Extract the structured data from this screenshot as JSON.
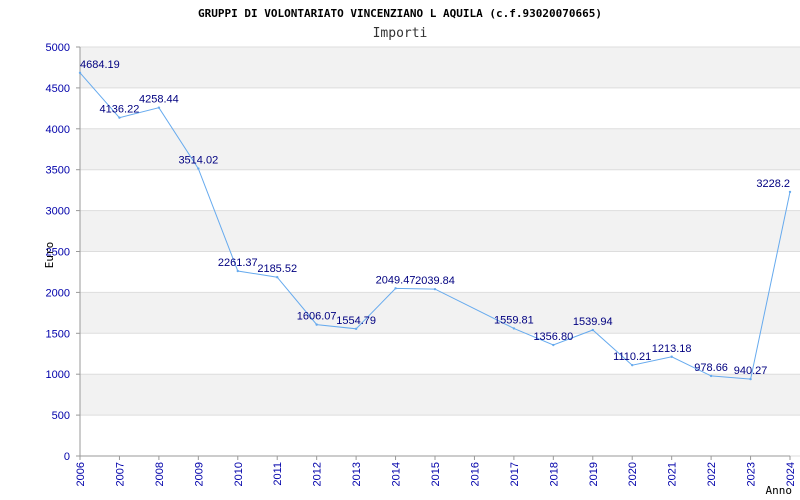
{
  "chart_data": {
    "type": "line",
    "title": "GRUPPI DI VOLONTARIATO VINCENZIANO L AQUILA (c.f.93020070665)",
    "subtitle": "Importi",
    "xlabel": "Anno",
    "ylabel": "Euro",
    "ylim": [
      0,
      5000
    ],
    "yticks": [
      "0",
      "500",
      "1000",
      "1500",
      "2000",
      "2500",
      "3000",
      "3500",
      "4000",
      "4500",
      "5000"
    ],
    "categories": [
      "2006",
      "2007",
      "2008",
      "2009",
      "2010",
      "2011",
      "2012",
      "2013",
      "2014",
      "2015",
      "2016",
      "2017",
      "2018",
      "2019",
      "2020",
      "2021",
      "2022",
      "2023",
      "2024"
    ],
    "values": [
      4684.19,
      4136.22,
      4258.44,
      3514.02,
      2261.37,
      2185.52,
      1606.07,
      1554.79,
      2049.47,
      2039.84,
      null,
      1559.81,
      1356.8,
      1539.94,
      1110.21,
      1213.18,
      978.66,
      940.27,
      3228.2
    ],
    "point_labels": [
      "4684.19",
      "4136.22",
      "4258.44",
      "3514.02",
      "2261.37",
      "2185.52",
      "1606.07",
      "1554.79",
      "2049.47",
      "2039.84",
      "",
      "1559.81",
      "1356.80",
      "1539.94",
      "1110.21",
      "1213.18",
      "978.66",
      "940.27",
      "3228.2"
    ],
    "grid": true,
    "colors": {
      "line": "#66aaee",
      "band": "#f2f2f2",
      "tick_text": "#0000aa",
      "label_text": "#000080"
    }
  }
}
